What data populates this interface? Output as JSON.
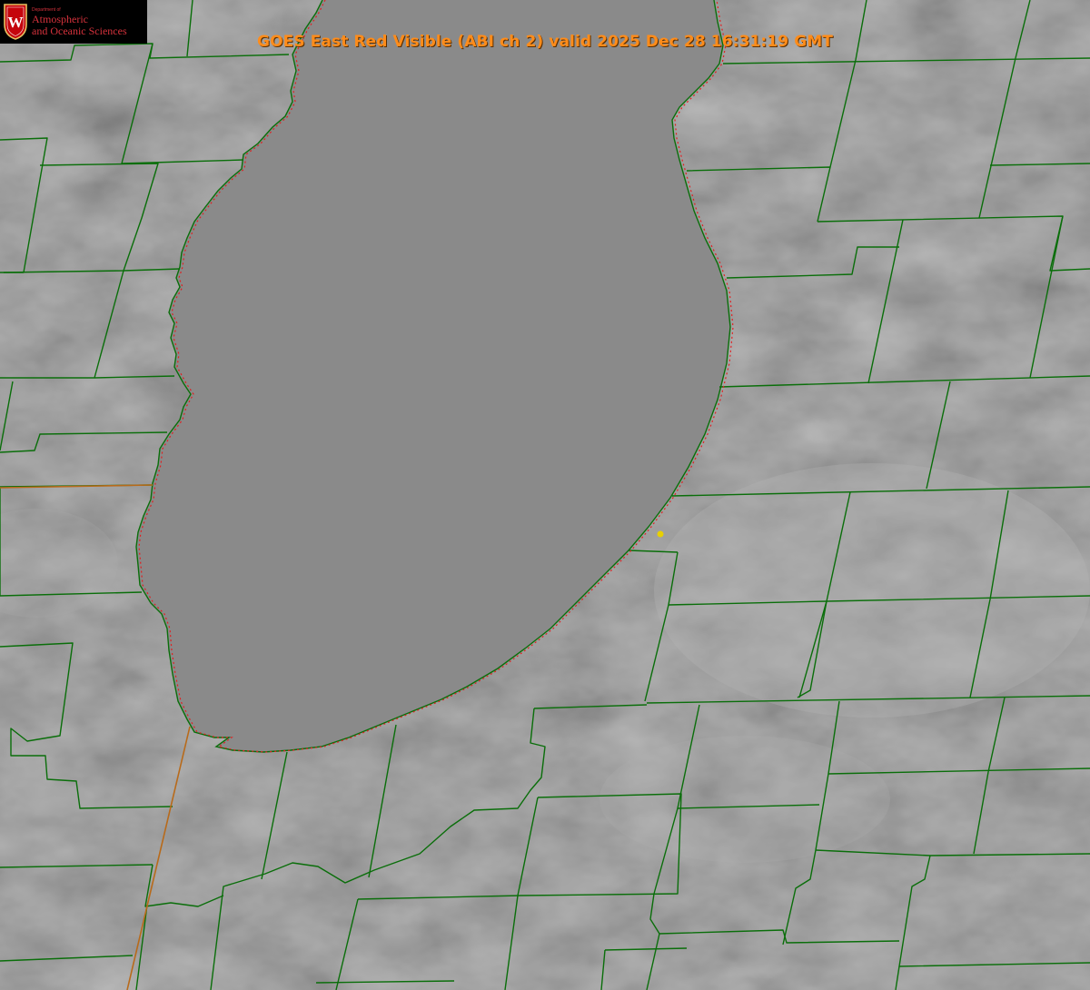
{
  "title": "GOES East Red Visible (ABI ch 2) valid 2025 Dec 28 16:31:19 GMT",
  "logo": {
    "department_text": "Department of",
    "line1": "Atmospheric",
    "line2": "and Oceanic Sciences",
    "crest_letter": "W"
  },
  "colors": {
    "title": "#ff8c1a",
    "boundaries": "#0a6e0a",
    "shoreline": "#e02020",
    "station_marker": "#e8d000",
    "logo_text": "#d6323c",
    "crest": "#c5050c"
  },
  "icons": {
    "crest": "university-crest-icon",
    "station": "station-marker-icon"
  }
}
